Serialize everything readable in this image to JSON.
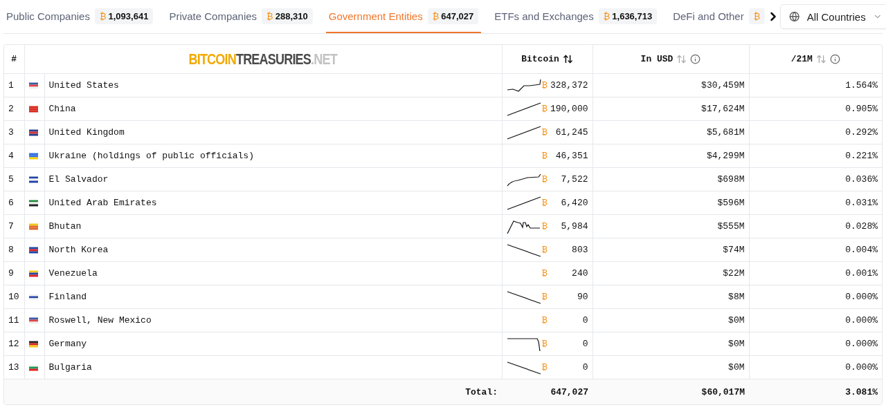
{
  "tabs": [
    {
      "label": "Public Companies",
      "symbol": "₿",
      "count": "1,093,641",
      "selected": false
    },
    {
      "label": "Private Companies",
      "symbol": "₿",
      "count": "288,310",
      "selected": false
    },
    {
      "label": "Government Entities",
      "symbol": "₿",
      "count": "647,027",
      "selected": true
    },
    {
      "label": "ETFs and Exchanges",
      "symbol": "₿",
      "count": "1,636,713",
      "selected": false
    },
    {
      "label": "DeFi and Other",
      "symbol": "₿",
      "selected": false
    }
  ],
  "country_filter": {
    "value": "All Countries"
  },
  "table": {
    "columns": {
      "rank": "#",
      "logo": [
        "BITCOIN",
        "TREASURIES",
        ".NET"
      ],
      "bitcoin": "Bitcoin",
      "usd": "In USD",
      "share": "/21M"
    },
    "rows": [
      {
        "rank": "1",
        "flag": {
          "kind": "us"
        },
        "name": "United States",
        "sparkline": {
          "kind": "stepup"
        },
        "symbol": "₿",
        "bitcoin": "328,372",
        "usd": "$30,459M",
        "share": "1.564%"
      },
      {
        "rank": "2",
        "flag": {
          "kind": "cn"
        },
        "name": "China",
        "sparkline": {
          "kind": "up"
        },
        "symbol": "₿",
        "bitcoin": "190,000",
        "usd": "$17,624M",
        "share": "0.905%"
      },
      {
        "rank": "3",
        "flag": {
          "kind": "gb"
        },
        "name": "United Kingdom",
        "sparkline": {
          "kind": "up"
        },
        "symbol": "₿",
        "bitcoin": "61,245",
        "usd": "$5,681M",
        "share": "0.292%"
      },
      {
        "rank": "4",
        "flag": {
          "kind": "ua"
        },
        "name": "Ukraine (holdings of public officials)",
        "symbol": "₿",
        "bitcoin": "46,351",
        "usd": "$4,299M",
        "share": "0.221%"
      },
      {
        "rank": "5",
        "flag": {
          "kind": "sv"
        },
        "name": "El Salvador",
        "sparkline": {
          "kind": "rise"
        },
        "symbol": "₿",
        "bitcoin": "7,522",
        "usd": "$698M",
        "share": "0.036%"
      },
      {
        "rank": "6",
        "flag": {
          "kind": "ae"
        },
        "name": "United Arab Emirates",
        "sparkline": {
          "kind": "up"
        },
        "symbol": "₿",
        "bitcoin": "6,420",
        "usd": "$596M",
        "share": "0.031%"
      },
      {
        "rank": "7",
        "flag": {
          "kind": "bt"
        },
        "name": "Bhutan",
        "sparkline": {
          "kind": "peak"
        },
        "symbol": "₿",
        "bitcoin": "5,984",
        "usd": "$555M",
        "share": "0.028%"
      },
      {
        "rank": "8",
        "flag": {
          "kind": "kp"
        },
        "name": "North Korea",
        "sparkline": {
          "kind": "down"
        },
        "symbol": "₿",
        "bitcoin": "803",
        "usd": "$74M",
        "share": "0.004%"
      },
      {
        "rank": "9",
        "flag": {
          "kind": "ve"
        },
        "name": "Venezuela",
        "symbol": "₿",
        "bitcoin": "240",
        "usd": "$22M",
        "share": "0.001%"
      },
      {
        "rank": "10",
        "flag": {
          "kind": "fi"
        },
        "name": "Finland",
        "sparkline": {
          "kind": "down"
        },
        "symbol": "₿",
        "bitcoin": "90",
        "usd": "$8M",
        "share": "0.000%"
      },
      {
        "rank": "11",
        "flag": {
          "kind": "us"
        },
        "name": "Roswell, New Mexico",
        "symbol": "₿",
        "bitcoin": "0",
        "usd": "$0M",
        "share": "0.000%"
      },
      {
        "rank": "12",
        "flag": {
          "kind": "de"
        },
        "name": "Germany",
        "sparkline": {
          "kind": "drop"
        },
        "symbol": "₿",
        "bitcoin": "0",
        "usd": "$0M",
        "share": "0.000%"
      },
      {
        "rank": "13",
        "flag": {
          "kind": "bg"
        },
        "name": "Bulgaria",
        "sparkline": {
          "kind": "down"
        },
        "symbol": "₿",
        "bitcoin": "0",
        "usd": "$0M",
        "share": "0.000%"
      }
    ],
    "total": {
      "label": "Total:",
      "bitcoin": "647,027",
      "usd": "$60,017M",
      "share": "3.081%"
    }
  }
}
